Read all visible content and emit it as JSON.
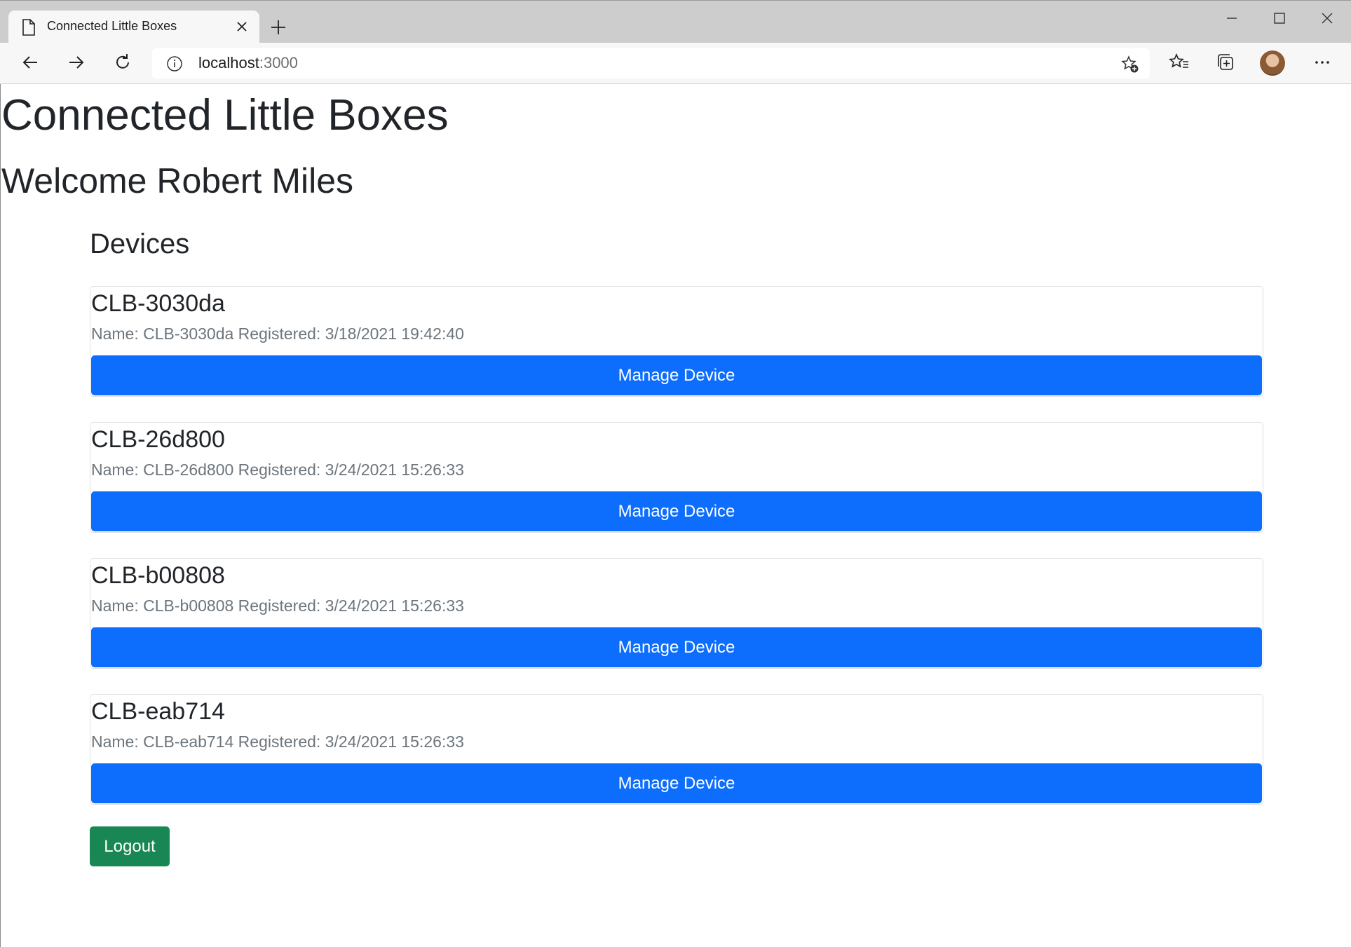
{
  "browser": {
    "tab_title": "Connected Little Boxes",
    "url_host": "localhost",
    "url_port": ":3000"
  },
  "page": {
    "title": "Connected Little Boxes",
    "welcome": "Welcome Robert Miles",
    "devices_heading": "Devices",
    "devices": [
      {
        "title": "CLB-3030da",
        "details": "Name: CLB-3030da Registered: 3/18/2021 19:42:40",
        "button": "Manage Device"
      },
      {
        "title": "CLB-26d800",
        "details": "Name: CLB-26d800 Registered: 3/24/2021 15:26:33",
        "button": "Manage Device"
      },
      {
        "title": "CLB-b00808",
        "details": "Name: CLB-b00808 Registered: 3/24/2021 15:26:33",
        "button": "Manage Device"
      },
      {
        "title": "CLB-eab714",
        "details": "Name: CLB-eab714 Registered: 3/24/2021 15:26:33",
        "button": "Manage Device"
      }
    ],
    "logout_label": "Logout"
  },
  "colors": {
    "primary": "#0d6efd",
    "success": "#198754",
    "muted_text": "#6c757d"
  },
  "icons": [
    "page-icon",
    "close-icon",
    "plus-icon",
    "minimize-icon",
    "maximize-icon",
    "window-close-icon",
    "back-icon",
    "forward-icon",
    "refresh-icon",
    "info-icon",
    "add-favorite-icon",
    "favorites-icon",
    "collections-icon",
    "more-icon"
  ]
}
